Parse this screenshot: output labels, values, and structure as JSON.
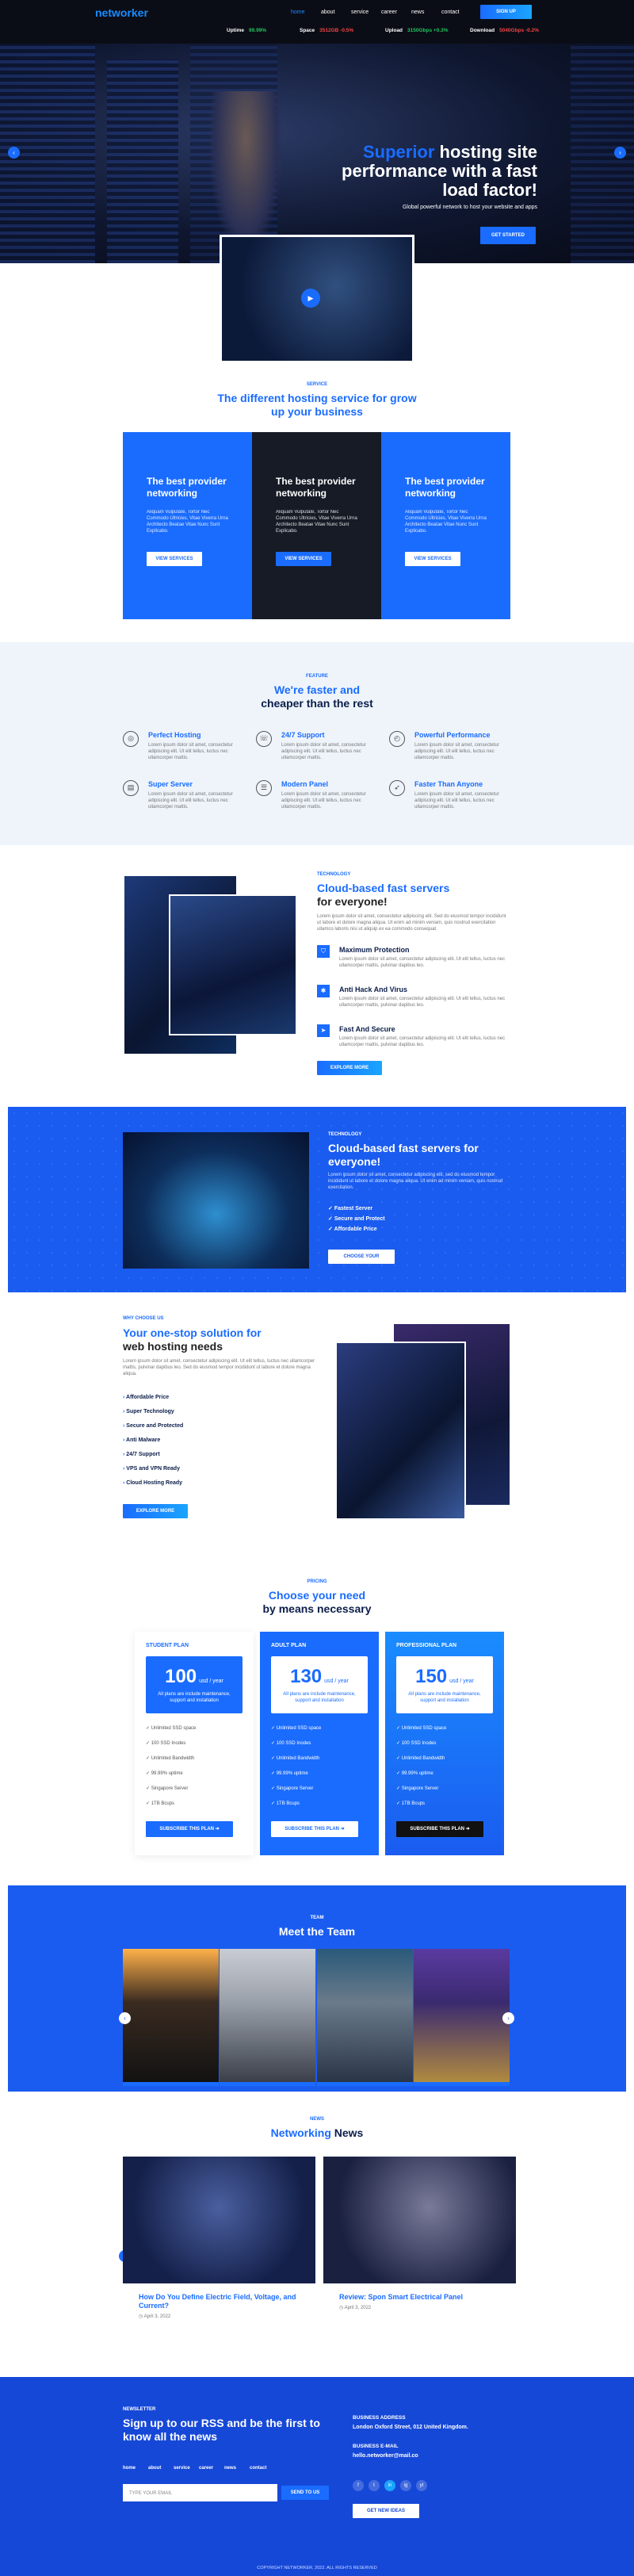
{
  "header": {
    "logo": "networker",
    "nav": [
      "home",
      "about",
      "service",
      "career",
      "news",
      "contact"
    ],
    "signup": "SIGN UP",
    "stats": [
      {
        "label": "Uptime",
        "value": "99.99%",
        "color": "green"
      },
      {
        "label": "Space",
        "value": "3512GB -0.5%",
        "color": "red"
      },
      {
        "label": "Upload",
        "value": "3150Gbps +0.3%",
        "color": "green"
      },
      {
        "label": "Download",
        "value": "5040Gbps -0.2%",
        "color": "red"
      }
    ]
  },
  "hero": {
    "title_accent": "Superior",
    "title_rest": " hosting site performance with a fast load factor!",
    "subtitle": "Global powerful network to host your website and apps",
    "cta": "GET STARTED"
  },
  "services": {
    "eyebrow": "SERVICE",
    "title": "The different hosting service for grow up your business",
    "cards": [
      {
        "title": "The best provider networking",
        "text": "Aliquam Vulputate, Tortor Nec Commodo Ultricies, Vitae Viverra Urna Architecto Beatae Vitae Nunc Sunt Explicabo.",
        "btn": "VIEW SERVICES",
        "bg": "#1a6cff"
      },
      {
        "title": "The best provider networking",
        "text": "Aliquam Vulputate, Tortor Nec Commodo Ultricies, Vitae Viverra Urna Architecto Beatae Vitae Nunc Sunt Explicabo.",
        "btn": "VIEW SERVICES",
        "bg": "#161b26"
      },
      {
        "title": "The best provider networking",
        "text": "Aliquam Vulputate, Tortor Nec Commodo Ultricies, Vitae Viverra Urna Architecto Beatae Vitae Nunc Sunt Explicabo.",
        "btn": "VIEW SERVICES",
        "bg": "#1a6cff"
      }
    ]
  },
  "features": {
    "eyebrow": "FEATURE",
    "title_accent": "We're faster and",
    "title_rest": "cheaper than the rest",
    "items": [
      {
        "title": "Perfect Hosting",
        "icon": "globe-icon",
        "glyph": "◎",
        "text": "Lorem ipsum dolor sit amet, consectetur adipiscing elit. Ut elit tellus, luctus nec ullamcorper mattis."
      },
      {
        "title": "24/7 Support",
        "icon": "support-icon",
        "glyph": "☏",
        "text": "Lorem ipsum dolor sit amet, consectetur adipiscing elit. Ut elit tellus, luctus nec ullamcorper mattis."
      },
      {
        "title": "Powerful Performance",
        "icon": "speed-icon",
        "glyph": "◴",
        "text": "Lorem ipsum dolor sit amet, consectetur adipiscing elit. Ut elit tellus, luctus nec ullamcorper mattis."
      },
      {
        "title": "Super Server",
        "icon": "server-icon",
        "glyph": "▤",
        "text": "Lorem ipsum dolor sit amet, consectetur adipiscing elit. Ut elit tellus, luctus nec ullamcorper mattis."
      },
      {
        "title": "Modern Panel",
        "icon": "panel-icon",
        "glyph": "☰",
        "text": "Lorem ipsum dolor sit amet, consectetur adipiscing elit. Ut elit tellus, luctus nec ullamcorper mattis."
      },
      {
        "title": "Faster Than Anyone",
        "icon": "rocket-icon",
        "glyph": "➶",
        "text": "Lorem ipsum dolor sit amet, consectetur adipiscing elit. Ut elit tellus, luctus nec ullamcorper mattis."
      }
    ]
  },
  "tech": {
    "eyebrow": "TECHNOLOGY",
    "title_accent": "Cloud-based fast servers",
    "title_rest": "for everyone!",
    "text": "Lorem ipsum dolor sit amet, consectetur adipiscing elit. Sed do eiusmod tempor incididunt ut labore et dolore magna aliqua. Ut enim ad minim veniam, quis nostrud exercitation ullamco laboris nisi ut aliquip ex ea commodo consequat.",
    "items": [
      {
        "title": "Maximum Protection",
        "icon": "shield-icon",
        "glyph": "⛉",
        "text": "Lorem ipsum dolor sit amet, consectetur adipiscing elit. Ut elit tellus, luctus nec ullamcorper mattis, pulvinar dapibus leo."
      },
      {
        "title": "Anti Hack And Virus",
        "icon": "bug-icon",
        "glyph": "✱",
        "text": "Lorem ipsum dolor sit amet, consectetur adipiscing elit. Ut elit tellus, luctus nec ullamcorper mattis, pulvinar dapibus leo."
      },
      {
        "title": "Fast And Secure",
        "icon": "send-icon",
        "glyph": "➤",
        "text": "Lorem ipsum dolor sit amet, consectetur adipiscing elit. Ut elit tellus, luctus nec ullamcorper mattis, pulvinar dapibus leo."
      }
    ],
    "btn": "EXPLORE MORE"
  },
  "band": {
    "eyebrow": "TECHNOLOGY",
    "title": "Cloud-based fast servers for everyone!",
    "text": "Lorem ipsum dolor sit amet, consectetur adipiscing elit, sed do eiusmod tempor incididunt ut labore et dolore magna aliqua. Ut enim ad minim veniam, quis nostrud exercitation.",
    "items": [
      "Fastest Server",
      "Secure and Protect",
      "Affordable Price"
    ],
    "btn": "CHOOSE YOUR PLANS"
  },
  "why": {
    "eyebrow": "WHY CHOOSE US",
    "title_accent": "Your one-stop solution for",
    "title_rest": "web hosting needs",
    "text": "Lorem ipsum dolor sit amet, consectetur adipiscing elit. Ut elit tellus, luctus nec ullamcorper mattis, pulvinar dapibus leo. Sed do eiusmod tempor incididunt ut labore et dolore magna aliqua.",
    "items": [
      "Affordable Price",
      "Super Technology",
      "Secure and Protected",
      "Anti Malware",
      "24/7 Support",
      "VPS and VPN Ready",
      "Cloud Hosting Ready"
    ],
    "btn": "EXPLORE MORE"
  },
  "pricing": {
    "eyebrow": "PRICING",
    "title_accent": "Choose your need",
    "title_rest": "by means necessary",
    "plans": [
      {
        "name": "STUDENT PLAN",
        "price": "100",
        "unit": "usd / year",
        "desc": "All plans are include maintenance, support and installation",
        "features": [
          "Unlimited SSD space",
          "100 SSD Inodes",
          "Unlimited Bandwidth",
          "99.99% uptime",
          "Singapore Server",
          "1TB Bcups"
        ],
        "btn": "SUBSCRIBE THIS PLAN ➜"
      },
      {
        "name": "ADULT PLAN",
        "price": "130",
        "unit": "usd / year",
        "desc": "All plans are include maintenance, support and installation",
        "features": [
          "Unlimited SSD space",
          "100 SSD Inodes",
          "Unlimited Bandwidth",
          "99.99% uptime",
          "Singapore Server",
          "1TB Bcups"
        ],
        "btn": "SUBSCRIBE THIS PLAN ➜"
      },
      {
        "name": "PROFESSIONAL PLAN",
        "price": "150",
        "unit": "usd / year",
        "desc": "All plans are include maintenance, support and installation",
        "features": [
          "Unlimited SSD space",
          "100 SSD Inodes",
          "Unlimited Bandwidth",
          "99.99% uptime",
          "Singapore Server",
          "1TB Bcups"
        ],
        "btn": "SUBSCRIBE THIS PLAN ➜"
      }
    ]
  },
  "team": {
    "eyebrow": "TEAM",
    "title": "Meet the Team"
  },
  "news": {
    "eyebrow": "NEWS",
    "title_accent": "Networking",
    "title_rest": " News",
    "posts": [
      {
        "title": "How Do You Define Electric Field, Voltage, and Current?",
        "date": "April 3, 2022"
      },
      {
        "title": "Review: Spon Smart Electrical Panel",
        "date": "April 3, 2022"
      }
    ]
  },
  "footer": {
    "eyebrow": "NEWSLETTER",
    "title": "Sign up to our RSS and be the first to know all the news",
    "links": [
      "home",
      "about",
      "service",
      "career",
      "news",
      "contact"
    ],
    "email_placeholder": "TYPE YOUR EMAIL",
    "send": "SEND TO US",
    "addr_label": "BUSINESS ADDRESS",
    "addr": "London Oxford Street, 012 United Kingdom.",
    "mail_label": "BUSINESS E-MAIL",
    "mail": "hello.networker@mail.co",
    "social": [
      "f",
      "t",
      "in",
      "ig",
      "yt"
    ],
    "cta": "GET NEW IDEAS",
    "copyright": "COPYRIGHT NETWORKER, 2022. ALL RIGHTS RESERVED"
  }
}
